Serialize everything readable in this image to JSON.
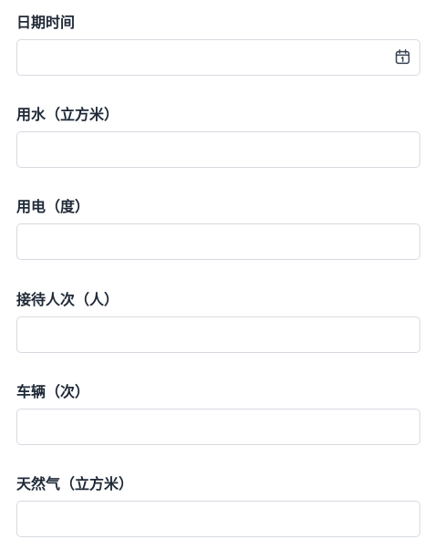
{
  "form": {
    "fields": [
      {
        "label": "日期时间",
        "value": "",
        "placeholder": ""
      },
      {
        "label": "用水（立方米）",
        "value": "",
        "placeholder": ""
      },
      {
        "label": "用电（度）",
        "value": "",
        "placeholder": ""
      },
      {
        "label": "接待人次（人）",
        "value": "",
        "placeholder": ""
      },
      {
        "label": "车辆（次）",
        "value": "",
        "placeholder": ""
      },
      {
        "label": "天然气（立方米）",
        "value": "",
        "placeholder": ""
      }
    ],
    "icons": {
      "datetime": "calendar-icon"
    }
  }
}
